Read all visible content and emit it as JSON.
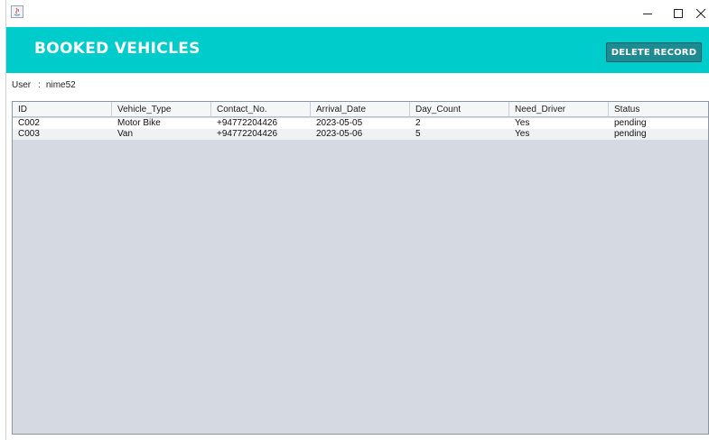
{
  "header": {
    "title": "BOOKED VEHICLES",
    "delete_label": "DELETE RECORD"
  },
  "user": {
    "label": "User",
    "separator": ":",
    "name": "nime52"
  },
  "table": {
    "columns": [
      "ID",
      "Vehicle_Type",
      "Contact_No.",
      "Arrival_Date",
      "Day_Count",
      "Need_Driver",
      "Status"
    ],
    "rows": [
      [
        "C002",
        "Motor Bike",
        "+94772204426",
        "2023-05-05",
        "2",
        "Yes",
        "pending"
      ],
      [
        "C003",
        "Van",
        "+94772204426",
        "2023-05-06",
        "5",
        "Yes",
        "pending"
      ]
    ]
  },
  "colors": {
    "header_bg": "#00cccc",
    "button_bg": "#1e8a92",
    "table_bg": "#d5d9e2"
  }
}
